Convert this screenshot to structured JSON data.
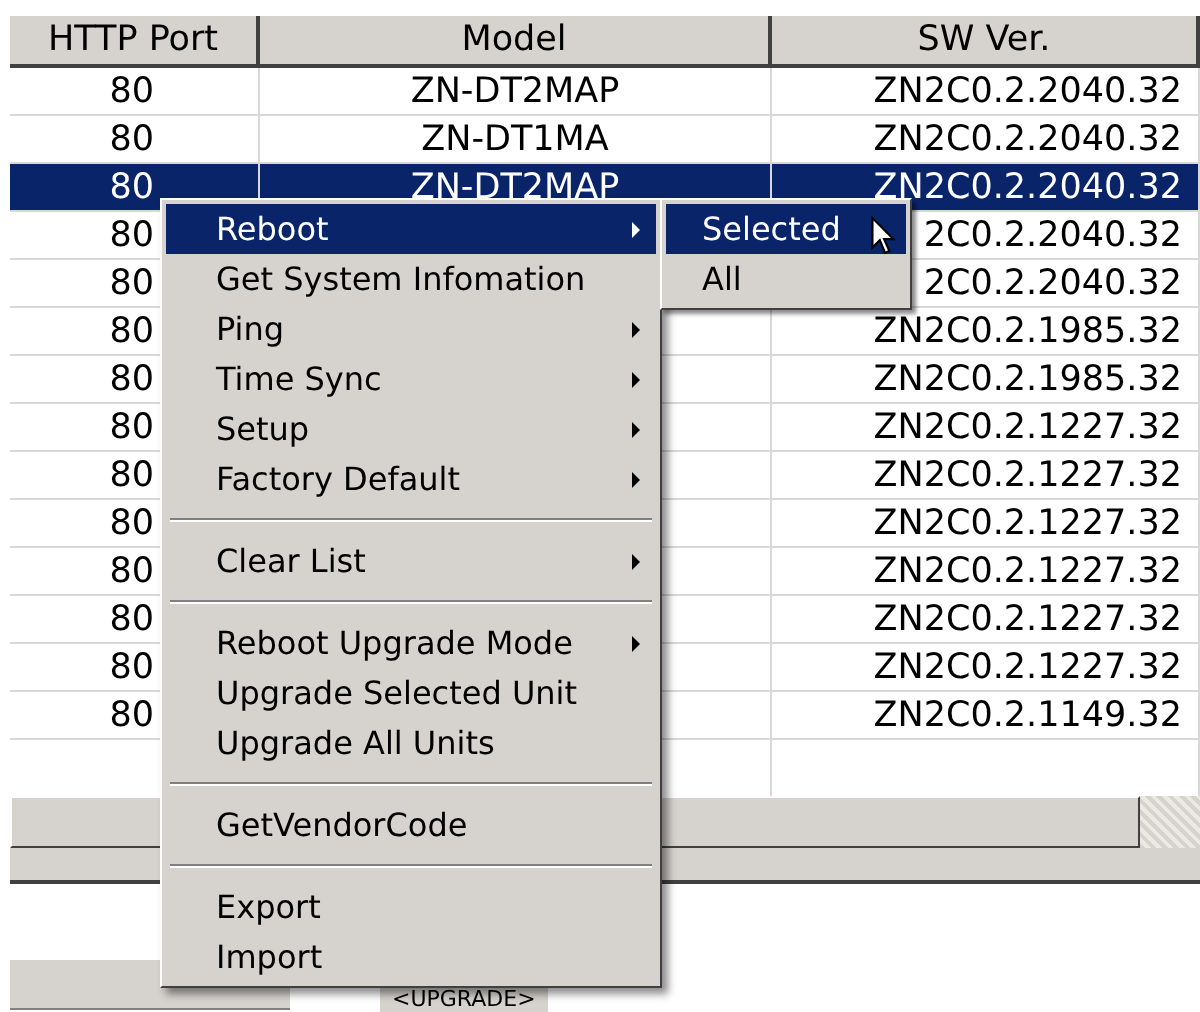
{
  "table": {
    "columns": [
      "HTTP Port",
      "Model",
      "SW Ver."
    ],
    "rows": [
      {
        "port": "80",
        "model": "ZN-DT2MAP",
        "sw_ver": "ZN2C0.2.2040.32",
        "selected": false
      },
      {
        "port": "80",
        "model": "ZN-DT1MA",
        "sw_ver": "ZN2C0.2.2040.32",
        "selected": false
      },
      {
        "port": "80",
        "model": "ZN-DT2MAP",
        "sw_ver": "ZN2C0.2.2040.32",
        "selected": true
      },
      {
        "port": "80",
        "sw_ver": "2C0.2.2040.32",
        "selected": false
      },
      {
        "port": "80",
        "sw_ver": "2C0.2.2040.32",
        "selected": false
      },
      {
        "port": "80",
        "sw_ver": "ZN2C0.2.1985.32",
        "selected": false
      },
      {
        "port": "80",
        "sw_ver": "ZN2C0.2.1985.32",
        "selected": false
      },
      {
        "port": "80",
        "sw_ver": "ZN2C0.2.1227.32",
        "selected": false
      },
      {
        "port": "80",
        "sw_ver": "ZN2C0.2.1227.32",
        "selected": false
      },
      {
        "port": "80",
        "sw_ver": "ZN2C0.2.1227.32",
        "selected": false
      },
      {
        "port": "80",
        "sw_ver": "ZN2C0.2.1227.32",
        "selected": false
      },
      {
        "port": "80",
        "sw_ver": "ZN2C0.2.1227.32",
        "selected": false
      },
      {
        "port": "80",
        "sw_ver": "ZN2C0.2.1227.32",
        "selected": false
      },
      {
        "port": "80",
        "sw_ver": "ZN2C0.2.1149.32",
        "selected": false
      }
    ]
  },
  "context_menu": {
    "items": [
      {
        "kind": "item",
        "label": "Reboot",
        "submenu": true,
        "selected": true
      },
      {
        "kind": "item",
        "label": "Get System Infomation",
        "submenu": false,
        "selected": false
      },
      {
        "kind": "item",
        "label": "Ping",
        "submenu": true,
        "selected": false
      },
      {
        "kind": "item",
        "label": "Time Sync",
        "submenu": true,
        "selected": false
      },
      {
        "kind": "item",
        "label": "Setup",
        "submenu": true,
        "selected": false
      },
      {
        "kind": "item",
        "label": "Factory Default",
        "submenu": true,
        "selected": false
      },
      {
        "kind": "separator"
      },
      {
        "kind": "item",
        "label": "Clear List",
        "submenu": true,
        "selected": false
      },
      {
        "kind": "separator"
      },
      {
        "kind": "item",
        "label": "Reboot Upgrade Mode",
        "submenu": true,
        "selected": false
      },
      {
        "kind": "item",
        "label": "Upgrade Selected Unit",
        "submenu": false,
        "selected": false
      },
      {
        "kind": "item",
        "label": "Upgrade All Units",
        "submenu": false,
        "selected": false
      },
      {
        "kind": "separator"
      },
      {
        "kind": "item",
        "label": "GetVendorCode",
        "submenu": false,
        "selected": false
      },
      {
        "kind": "separator"
      },
      {
        "kind": "item",
        "label": "Export",
        "submenu": false,
        "selected": false
      },
      {
        "kind": "item",
        "label": "Import",
        "submenu": false,
        "selected": false
      }
    ]
  },
  "submenu": {
    "items": [
      {
        "label": "Selected",
        "selected": true
      },
      {
        "label": "All",
        "selected": false
      }
    ]
  },
  "bottom_panel": {
    "label": "<UPGRADE>"
  }
}
